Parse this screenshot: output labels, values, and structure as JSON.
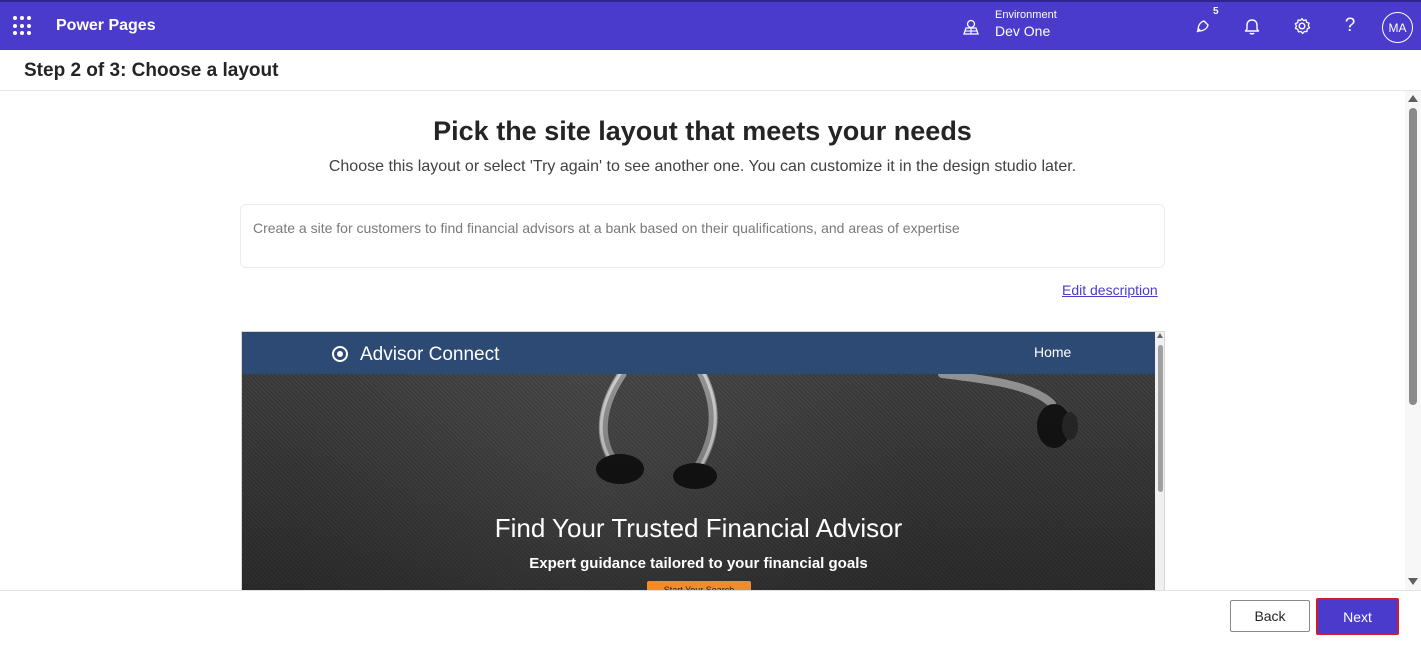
{
  "header": {
    "app_name": "Power Pages",
    "environment_label": "Environment",
    "environment_name": "Dev One",
    "notification_count": "5",
    "help_glyph": "?",
    "avatar_initials": "MA",
    "icons": [
      "waffle-icon",
      "environment-icon",
      "copilot-notifications-icon",
      "bell-icon",
      "settings-icon",
      "help-icon"
    ],
    "brand_color": "#4a3bcc"
  },
  "step": {
    "title": "Step 2 of 3: Choose a layout"
  },
  "main": {
    "heading": "Pick the site layout that meets your needs",
    "subheading": "Choose this layout or select 'Try again' to see another one. You can customize it in the design studio later.",
    "description": "Create a site for customers to find financial advisors at a bank based on their qualifications, and areas of expertise",
    "edit_link": "Edit description"
  },
  "preview": {
    "brand": "Advisor Connect",
    "nav_home": "Home",
    "hero_title": "Find Your Trusted Financial Advisor",
    "hero_subtitle": "Expert guidance tailored to your financial goals",
    "cta_label": "Start Your Search",
    "nav_color": "#2c4a73",
    "cta_color": "#f28c28"
  },
  "footer": {
    "back_label": "Back",
    "next_label": "Next"
  }
}
